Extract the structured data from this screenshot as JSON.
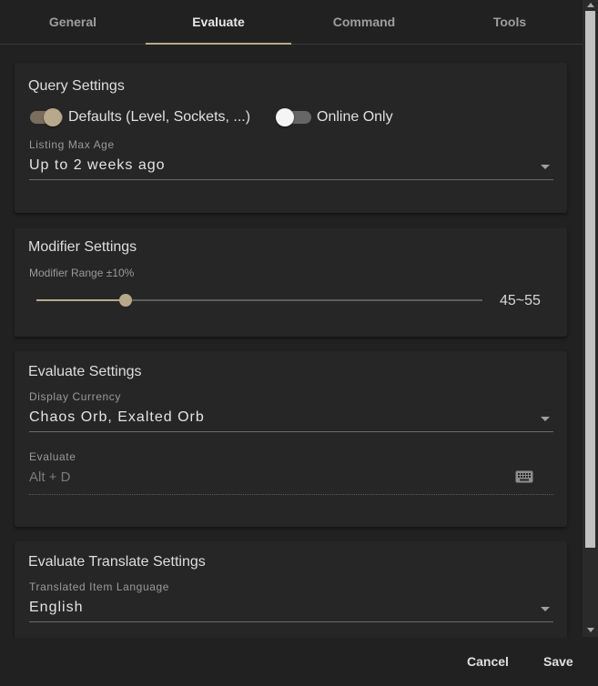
{
  "tabs": [
    {
      "label": "General"
    },
    {
      "label": "Evaluate",
      "active": true
    },
    {
      "label": "Command"
    },
    {
      "label": "Tools"
    }
  ],
  "query": {
    "title": "Query Settings",
    "defaults_toggle": {
      "label": "Defaults (Level, Sockets, ...)",
      "on": true
    },
    "online_toggle": {
      "label": "Online Only",
      "on": false
    },
    "max_age": {
      "label": "Listing Max Age",
      "value": "Up to 2 weeks ago"
    }
  },
  "modifier": {
    "title": "Modifier Settings",
    "range_label": "Modifier Range ±10%",
    "range_value": "45~55",
    "slider_fraction": 0.2
  },
  "evaluate": {
    "title": "Evaluate Settings",
    "currency": {
      "label": "Display Currency",
      "value": "Chaos Orb, Exalted Orb"
    },
    "hotkey": {
      "label": "Evaluate",
      "value": "Alt + D",
      "icon": "keyboard-icon"
    }
  },
  "translate": {
    "title": "Evaluate Translate Settings",
    "language": {
      "label": "Translated Item Language",
      "value": "English"
    }
  },
  "footer": {
    "cancel_label": "Cancel",
    "save_label": "Save"
  },
  "colors": {
    "accent": "#b8a98c",
    "background": "#212121",
    "card": "#262626"
  }
}
